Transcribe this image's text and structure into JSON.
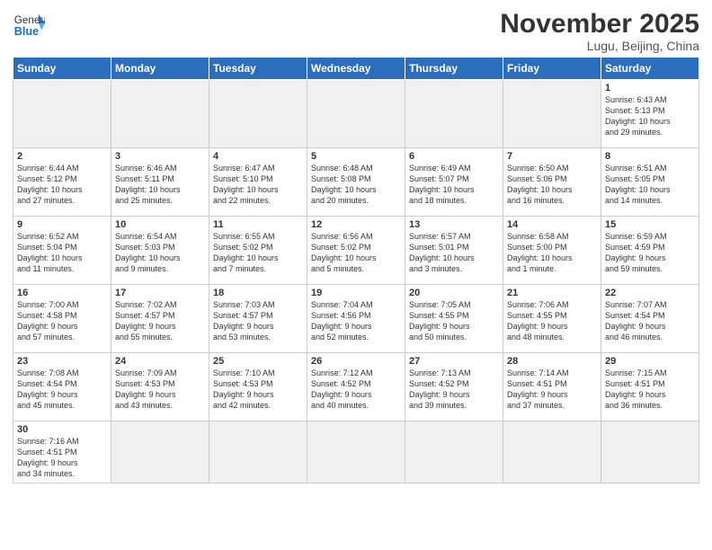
{
  "header": {
    "logo_general": "General",
    "logo_blue": "Blue",
    "month_year": "November 2025",
    "location": "Lugu, Beijing, China"
  },
  "days_of_week": [
    "Sunday",
    "Monday",
    "Tuesday",
    "Wednesday",
    "Thursday",
    "Friday",
    "Saturday"
  ],
  "weeks": [
    [
      {
        "day": "",
        "info": "",
        "empty": true
      },
      {
        "day": "",
        "info": "",
        "empty": true
      },
      {
        "day": "",
        "info": "",
        "empty": true
      },
      {
        "day": "",
        "info": "",
        "empty": true
      },
      {
        "day": "",
        "info": "",
        "empty": true
      },
      {
        "day": "",
        "info": "",
        "empty": true
      },
      {
        "day": "1",
        "info": "Sunrise: 6:43 AM\nSunset: 5:13 PM\nDaylight: 10 hours\nand 29 minutes."
      }
    ],
    [
      {
        "day": "2",
        "info": "Sunrise: 6:44 AM\nSunset: 5:12 PM\nDaylight: 10 hours\nand 27 minutes."
      },
      {
        "day": "3",
        "info": "Sunrise: 6:46 AM\nSunset: 5:11 PM\nDaylight: 10 hours\nand 25 minutes."
      },
      {
        "day": "4",
        "info": "Sunrise: 6:47 AM\nSunset: 5:10 PM\nDaylight: 10 hours\nand 22 minutes."
      },
      {
        "day": "5",
        "info": "Sunrise: 6:48 AM\nSunset: 5:08 PM\nDaylight: 10 hours\nand 20 minutes."
      },
      {
        "day": "6",
        "info": "Sunrise: 6:49 AM\nSunset: 5:07 PM\nDaylight: 10 hours\nand 18 minutes."
      },
      {
        "day": "7",
        "info": "Sunrise: 6:50 AM\nSunset: 5:06 PM\nDaylight: 10 hours\nand 16 minutes."
      },
      {
        "day": "8",
        "info": "Sunrise: 6:51 AM\nSunset: 5:05 PM\nDaylight: 10 hours\nand 14 minutes."
      }
    ],
    [
      {
        "day": "9",
        "info": "Sunrise: 6:52 AM\nSunset: 5:04 PM\nDaylight: 10 hours\nand 11 minutes."
      },
      {
        "day": "10",
        "info": "Sunrise: 6:54 AM\nSunset: 5:03 PM\nDaylight: 10 hours\nand 9 minutes."
      },
      {
        "day": "11",
        "info": "Sunrise: 6:55 AM\nSunset: 5:02 PM\nDaylight: 10 hours\nand 7 minutes."
      },
      {
        "day": "12",
        "info": "Sunrise: 6:56 AM\nSunset: 5:02 PM\nDaylight: 10 hours\nand 5 minutes."
      },
      {
        "day": "13",
        "info": "Sunrise: 6:57 AM\nSunset: 5:01 PM\nDaylight: 10 hours\nand 3 minutes."
      },
      {
        "day": "14",
        "info": "Sunrise: 6:58 AM\nSunset: 5:00 PM\nDaylight: 10 hours\nand 1 minute."
      },
      {
        "day": "15",
        "info": "Sunrise: 6:59 AM\nSunset: 4:59 PM\nDaylight: 9 hours\nand 59 minutes."
      }
    ],
    [
      {
        "day": "16",
        "info": "Sunrise: 7:00 AM\nSunset: 4:58 PM\nDaylight: 9 hours\nand 57 minutes."
      },
      {
        "day": "17",
        "info": "Sunrise: 7:02 AM\nSunset: 4:57 PM\nDaylight: 9 hours\nand 55 minutes."
      },
      {
        "day": "18",
        "info": "Sunrise: 7:03 AM\nSunset: 4:57 PM\nDaylight: 9 hours\nand 53 minutes."
      },
      {
        "day": "19",
        "info": "Sunrise: 7:04 AM\nSunset: 4:56 PM\nDaylight: 9 hours\nand 52 minutes."
      },
      {
        "day": "20",
        "info": "Sunrise: 7:05 AM\nSunset: 4:55 PM\nDaylight: 9 hours\nand 50 minutes."
      },
      {
        "day": "21",
        "info": "Sunrise: 7:06 AM\nSunset: 4:55 PM\nDaylight: 9 hours\nand 48 minutes."
      },
      {
        "day": "22",
        "info": "Sunrise: 7:07 AM\nSunset: 4:54 PM\nDaylight: 9 hours\nand 46 minutes."
      }
    ],
    [
      {
        "day": "23",
        "info": "Sunrise: 7:08 AM\nSunset: 4:54 PM\nDaylight: 9 hours\nand 45 minutes."
      },
      {
        "day": "24",
        "info": "Sunrise: 7:09 AM\nSunset: 4:53 PM\nDaylight: 9 hours\nand 43 minutes."
      },
      {
        "day": "25",
        "info": "Sunrise: 7:10 AM\nSunset: 4:53 PM\nDaylight: 9 hours\nand 42 minutes."
      },
      {
        "day": "26",
        "info": "Sunrise: 7:12 AM\nSunset: 4:52 PM\nDaylight: 9 hours\nand 40 minutes."
      },
      {
        "day": "27",
        "info": "Sunrise: 7:13 AM\nSunset: 4:52 PM\nDaylight: 9 hours\nand 39 minutes."
      },
      {
        "day": "28",
        "info": "Sunrise: 7:14 AM\nSunset: 4:51 PM\nDaylight: 9 hours\nand 37 minutes."
      },
      {
        "day": "29",
        "info": "Sunrise: 7:15 AM\nSunset: 4:51 PM\nDaylight: 9 hours\nand 36 minutes."
      }
    ],
    [
      {
        "day": "30",
        "info": "Sunrise: 7:16 AM\nSunset: 4:51 PM\nDaylight: 9 hours\nand 34 minutes."
      },
      {
        "day": "",
        "info": "",
        "empty": true
      },
      {
        "day": "",
        "info": "",
        "empty": true
      },
      {
        "day": "",
        "info": "",
        "empty": true
      },
      {
        "day": "",
        "info": "",
        "empty": true
      },
      {
        "day": "",
        "info": "",
        "empty": true
      },
      {
        "day": "",
        "info": "",
        "empty": true
      }
    ]
  ]
}
